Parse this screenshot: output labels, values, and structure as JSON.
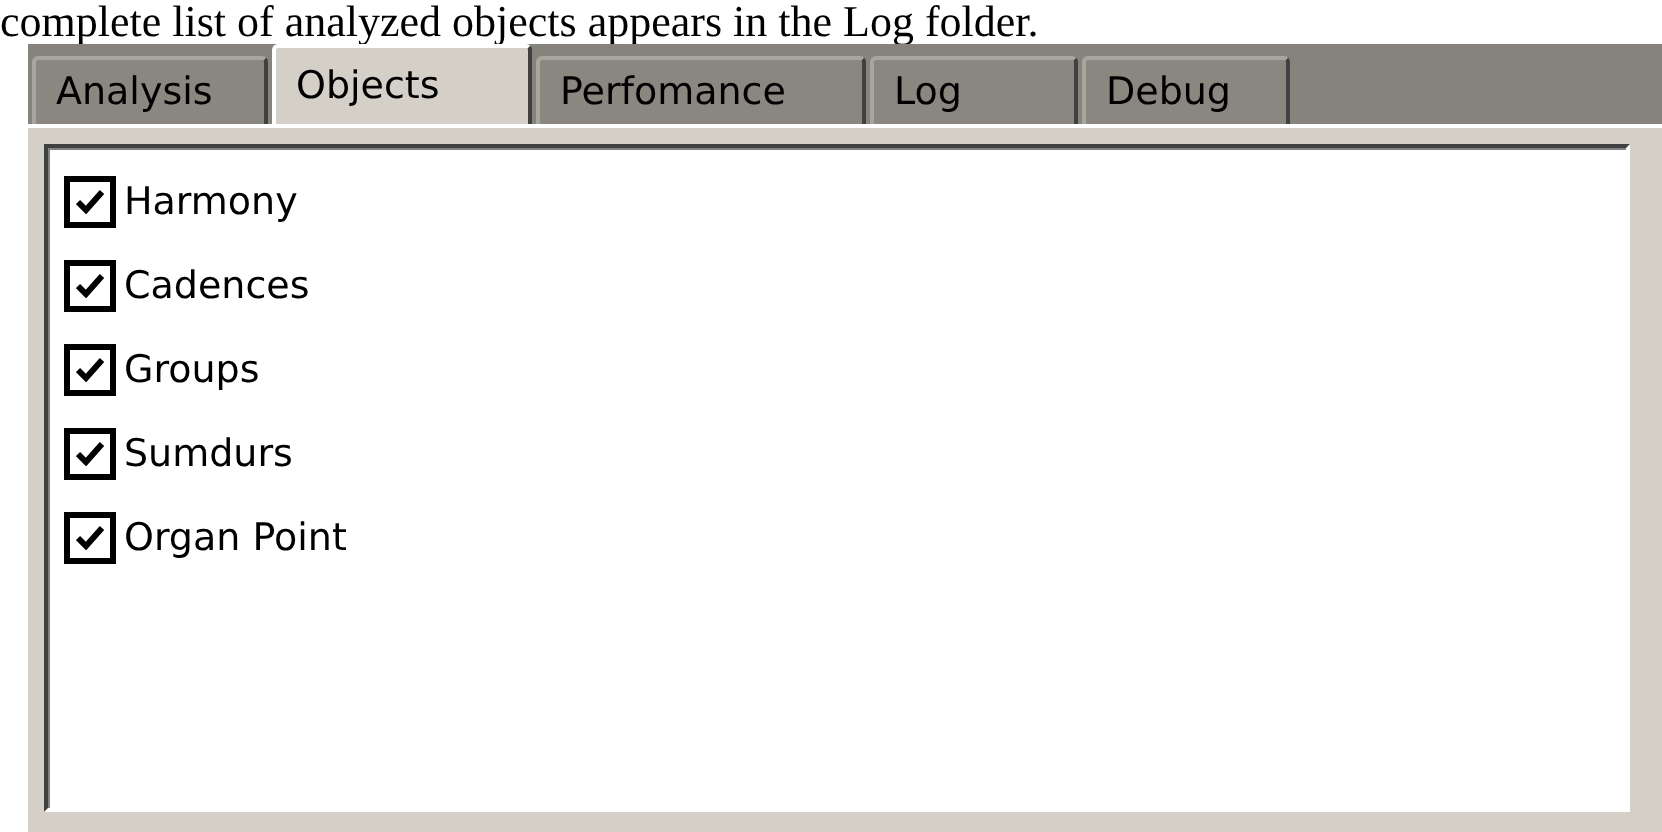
{
  "caption": "complete list of analyzed objects appears in the Log folder.",
  "tabs": [
    {
      "label": "Analysis",
      "selected": false
    },
    {
      "label": "Objects",
      "selected": true
    },
    {
      "label": "Perfomance",
      "selected": false
    },
    {
      "label": "Log",
      "selected": false
    },
    {
      "label": "Debug",
      "selected": false
    }
  ],
  "objects": [
    {
      "label": "Harmony",
      "checked": true
    },
    {
      "label": "Cadences",
      "checked": true
    },
    {
      "label": "Groups",
      "checked": true
    },
    {
      "label": "Sumdurs",
      "checked": true
    },
    {
      "label": "Organ Point",
      "checked": true
    }
  ]
}
